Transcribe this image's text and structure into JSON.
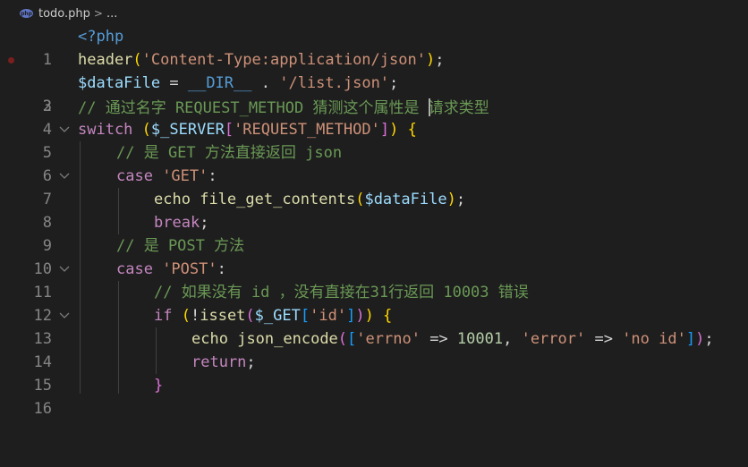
{
  "breadcrumb": {
    "icon": "php-file-icon",
    "icon_text": "php",
    "file": "todo.php",
    "separator": ">",
    "more": "..."
  },
  "editor": {
    "line_numbers": [
      "1",
      "2",
      "3",
      "4",
      "5",
      "6",
      "7",
      "8",
      "9",
      "10",
      "11",
      "12",
      "13",
      "14",
      "15",
      "16"
    ],
    "breakpoint_line": "2",
    "lines": {
      "l1": {
        "open_tag": "<?php"
      },
      "l2": {
        "fn": "header",
        "open": "(",
        "str": "'Content-Type:application/json'",
        "close": ")",
        "end": ";"
      },
      "l3": {
        "var": "$dataFile",
        "eq": " = ",
        "const": "__DIR__",
        "dot": " . ",
        "str": "'/list.json'",
        "end": ";"
      },
      "l4": {
        "comment_a": "// 通过名字 REQUEST_METHOD 猜测这个属性是 ",
        "comment_b": "请求类型"
      },
      "l5": {
        "kw": "switch",
        "sp": " ",
        "open": "(",
        "var": "$_SERVER",
        "bo": "[",
        "str": "'REQUEST_METHOD'",
        "bc": "]",
        "close": ")",
        "brace": " {"
      },
      "l6": {
        "comment": "// 是 GET 方法直接返回 json"
      },
      "l7": {
        "kw": "case",
        "str": " 'GET'",
        "colon": ":"
      },
      "l8": {
        "kw": "echo",
        "sp": " ",
        "fn": "file_get_contents",
        "open": "(",
        "var": "$dataFile",
        "close": ")",
        "end": ";"
      },
      "l9": {
        "kw": "break",
        "end": ";"
      },
      "l10": {
        "comment": "// 是 POST 方法"
      },
      "l11": {
        "kw": "case",
        "str": " 'POST'",
        "colon": ":"
      },
      "l12": {
        "comment": "// 如果没有 id ，没有直接在31行返回 10003 错误"
      },
      "l13": {
        "kw": "if",
        "sp": " ",
        "open": "(",
        "not": "!",
        "fn": "isset",
        "open2": "(",
        "var": "$_GET",
        "bo": "[",
        "str": "'id'",
        "bc": "]",
        "close2": ")",
        "close": ")",
        "brace": " {"
      },
      "l14": {
        "kw": "echo",
        "sp": " ",
        "fn": "json_encode",
        "open": "(",
        "bo": "[",
        "k1": "'errno'",
        "arrow1": " => ",
        "n1": "10001",
        "comma": ", ",
        "k2": "'error'",
        "arrow2": " => ",
        "v2": "'no id'",
        "bc": "]",
        "close": ")",
        "end": ";"
      },
      "l15": {
        "kw": "return",
        "end": ";"
      },
      "l16": {
        "brace": "}"
      }
    }
  },
  "colors": {
    "background": "#1e1e1e",
    "keyword": "#569cd6",
    "control": "#c586c0",
    "function": "#dcdcaa",
    "string": "#ce9178",
    "variable": "#9cdcfe",
    "comment": "#6a9955",
    "number": "#b5cea8",
    "breakpoint": "#7a1f1f"
  }
}
